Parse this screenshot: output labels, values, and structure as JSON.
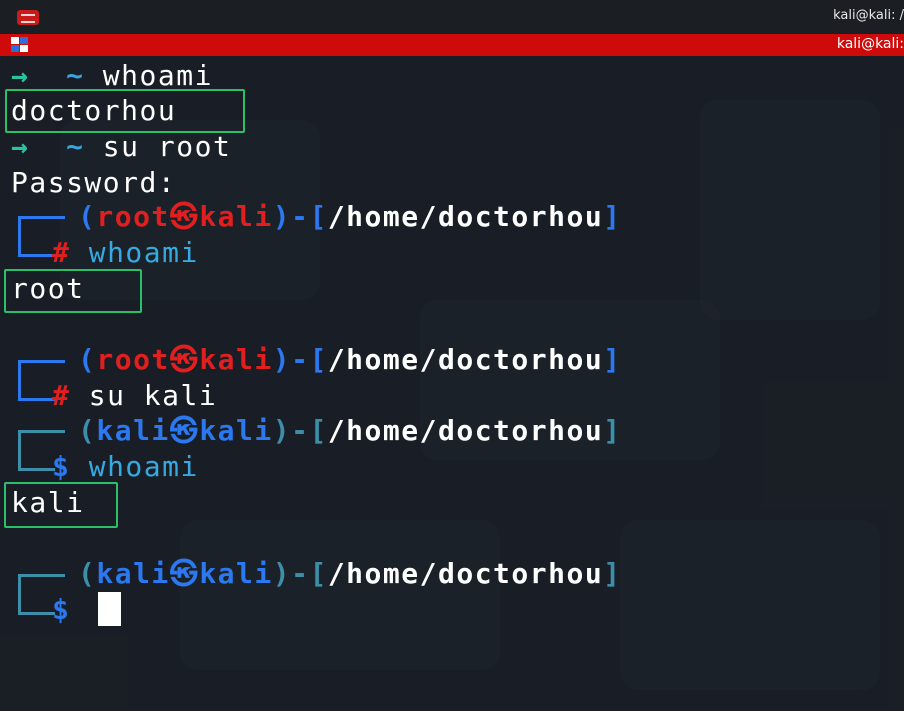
{
  "window": {
    "title": "kali@kali: /",
    "tab_title": "kali@kali:"
  },
  "terminal": {
    "prompt_arrow": "→",
    "prompt_dir": "~",
    "cmd1": "whoami",
    "out1": "doctorhou",
    "cmd2": "su root",
    "password_label": "Password:",
    "root_user": "root",
    "host": "kali",
    "at_symbol": "㉿",
    "cwd": "/home/doctorhou",
    "paren_open": "(",
    "paren_close": ")-[",
    "bracket_close": "]",
    "root_prompt": "#",
    "user_prompt": "$",
    "cmd3": "whoami",
    "out2": "root",
    "cmd4": "su kali",
    "kali_user": "kali",
    "cmd5": "whoami",
    "out3": "kali"
  },
  "colors": {
    "tab_bar": "#cf0a0a",
    "highlight_box": "#2bbf6a",
    "root_prompt": "#e21f1f",
    "user_prompt": "#2b78f0",
    "path": "#ffffff"
  }
}
